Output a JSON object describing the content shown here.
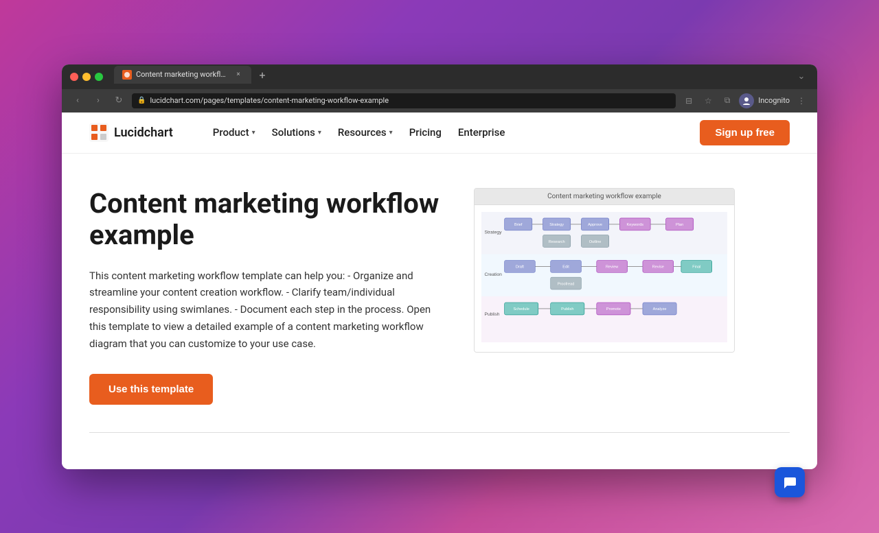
{
  "browser": {
    "tab_title": "Content marketing workflow e...",
    "tab_close": "×",
    "tab_new": "+",
    "nav_back": "‹",
    "nav_forward": "›",
    "nav_refresh": "↻",
    "address": "lucidchart.com/pages/templates/content-marketing-workflow-example",
    "incognito_label": "Incognito",
    "collapse_icon": "⌄"
  },
  "nav": {
    "logo_text": "Lucidchart",
    "product_label": "Product",
    "solutions_label": "Solutions",
    "resources_label": "Resources",
    "pricing_label": "Pricing",
    "enterprise_label": "Enterprise",
    "signup_label": "Sign up free"
  },
  "page": {
    "title": "Content marketing workflow example",
    "description": "This content marketing workflow template can help you: - Organize and streamline your content creation workflow. - Clarify team/individual responsibility using swimlanes. - Document each step in the process. Open this template to view a detailed example of a content marketing workflow diagram that you can customize to your use case.",
    "use_template_label": "Use this template",
    "diagram_title": "Content marketing workflow example"
  },
  "chat": {
    "icon": "💬"
  }
}
